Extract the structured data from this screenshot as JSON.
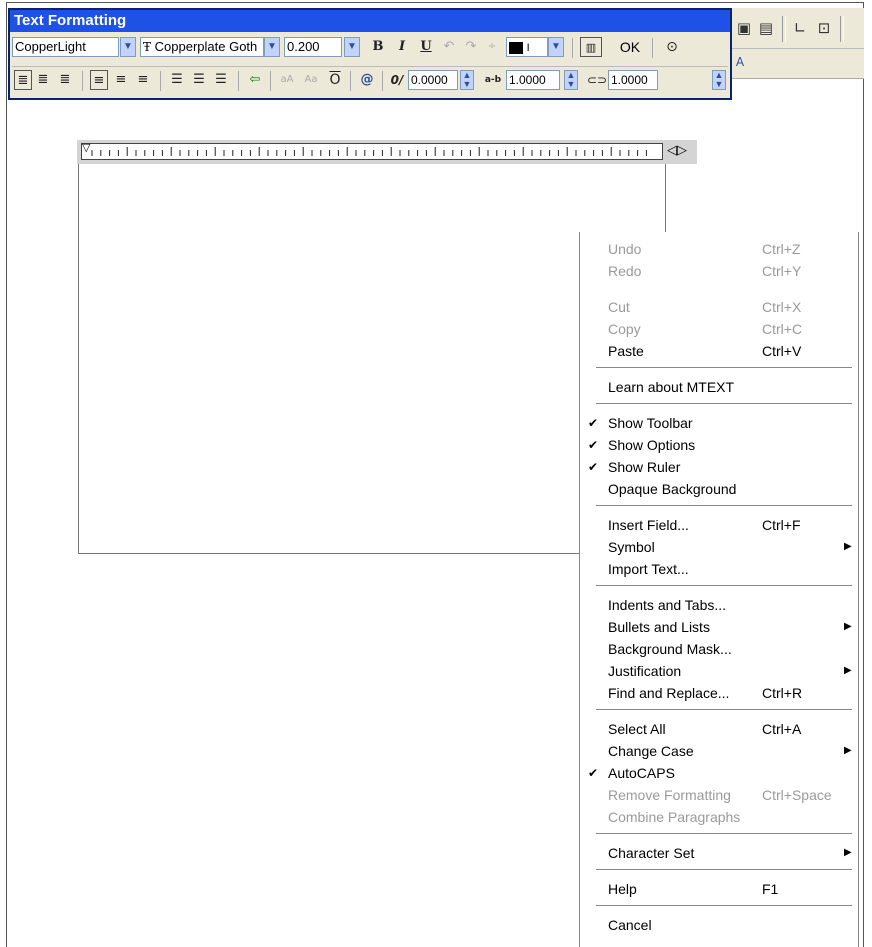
{
  "toolbar": {
    "title": "Text Formatting",
    "style": "CopperLight",
    "font": "Copperplate Goth",
    "height": "0.200",
    "bold": "B",
    "italic": "I",
    "underline": "U",
    "ok_label": "OK",
    "oblique": "0.0000",
    "tracking": "1.0000",
    "width_factor": "1.0000",
    "oblique_label": "0/",
    "tracking_label": "a-b",
    "color_label": "I"
  },
  "menu": {
    "items": [
      {
        "label": "Undo",
        "shortcut": "Ctrl+Z",
        "enabled": false
      },
      {
        "label": "Redo",
        "shortcut": "Ctrl+Y",
        "enabled": false
      },
      {
        "label": "Cut",
        "shortcut": "Ctrl+X",
        "enabled": false
      },
      {
        "label": "Copy",
        "shortcut": "Ctrl+C",
        "enabled": false
      },
      {
        "label": "Paste",
        "shortcut": "Ctrl+V",
        "enabled": true
      },
      {
        "label": "Learn about MTEXT",
        "shortcut": "",
        "enabled": true
      },
      {
        "label": "Show Toolbar",
        "checked": true,
        "enabled": true
      },
      {
        "label": "Show Options",
        "checked": true,
        "enabled": true
      },
      {
        "label": "Show Ruler",
        "checked": true,
        "enabled": true
      },
      {
        "label": "Opaque Background",
        "enabled": true
      },
      {
        "label": "Insert Field...",
        "shortcut": "Ctrl+F",
        "enabled": true
      },
      {
        "label": "Symbol",
        "submenu": true,
        "enabled": true
      },
      {
        "label": "Import Text...",
        "enabled": true
      },
      {
        "label": "Indents and Tabs...",
        "enabled": true
      },
      {
        "label": "Bullets and Lists",
        "submenu": true,
        "enabled": true
      },
      {
        "label": "Background Mask...",
        "enabled": true
      },
      {
        "label": "Justification",
        "submenu": true,
        "enabled": true
      },
      {
        "label": "Find and Replace...",
        "shortcut": "Ctrl+R",
        "enabled": true
      },
      {
        "label": "Select All",
        "shortcut": "Ctrl+A",
        "enabled": true
      },
      {
        "label": "Change Case",
        "submenu": true,
        "enabled": true
      },
      {
        "label": "AutoCAPS",
        "checked": true,
        "enabled": true
      },
      {
        "label": "Remove Formatting",
        "shortcut": "Ctrl+Space",
        "enabled": false
      },
      {
        "label": "Combine Paragraphs",
        "enabled": false
      },
      {
        "label": "Character Set",
        "submenu": true,
        "enabled": true
      },
      {
        "label": "Help",
        "shortcut": "F1",
        "enabled": true
      },
      {
        "label": "Cancel",
        "enabled": true
      }
    ],
    "check_glyph": "✔",
    "submenu_glyph": "▶"
  }
}
